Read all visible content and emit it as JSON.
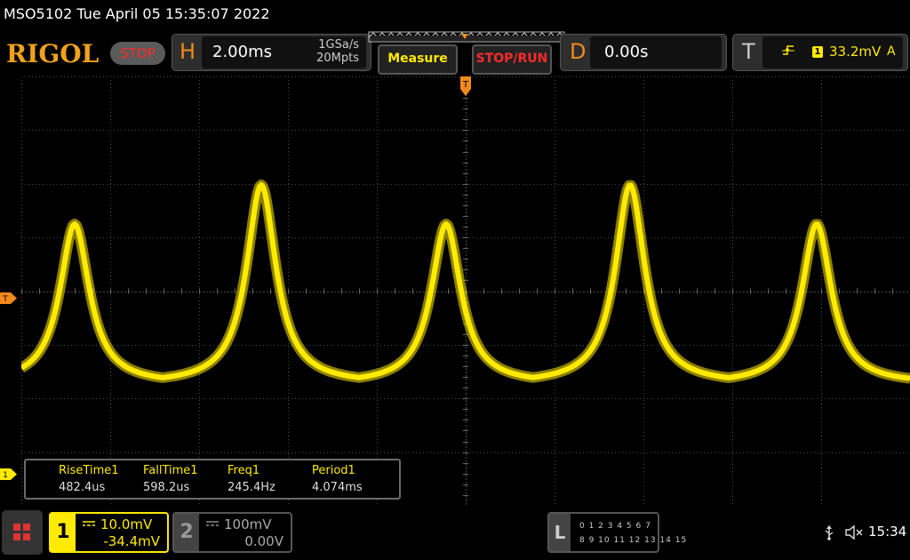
{
  "titlebar": {
    "text": "MSO5102  Tue April 05 15:35:07 2022"
  },
  "toolbar": {
    "logo": "RIGOL",
    "run_state": "STOP",
    "horizontal": {
      "letter": "H",
      "timebase": "2.00ms",
      "sample_rate": "1GSa/s",
      "memory_depth": "20Mpts"
    },
    "measure_label": "Measure",
    "stop_run_label": "STOP/RUN",
    "delay": {
      "letter": "D",
      "value": "0.00s"
    },
    "trigger": {
      "letter": "T",
      "source": "1",
      "level": "33.2mV",
      "mode": "A",
      "edge_icon": "rising-edge-icon"
    }
  },
  "markers": {
    "trigger_level": "T",
    "ch1_ground": "1"
  },
  "measurements": [
    {
      "label": "RiseTime1",
      "value": "482.4us"
    },
    {
      "label": "FallTime1",
      "value": "598.2us"
    },
    {
      "label": "Freq1",
      "value": "245.4Hz"
    },
    {
      "label": "Period1",
      "value": "4.074ms"
    }
  ],
  "channels": {
    "ch1": {
      "number": "1",
      "scale": "10.0mV",
      "offset": "-34.4mV",
      "color": "#ffea00"
    },
    "ch2": {
      "number": "2",
      "scale": "100mV",
      "offset": "0.00V",
      "color": "#888888"
    }
  },
  "logic": {
    "letter": "L",
    "row1": "0 1 2 3  4 5 6 7",
    "row2": "8 9 10 11 12 13 14 15"
  },
  "status": {
    "time": "15:34"
  },
  "colors": {
    "trace": "#ffea00",
    "accent": "#f28a1a",
    "stop": "#ff2a2a",
    "grid": "#4a4a4a"
  },
  "waveform": {
    "peaks": [
      {
        "x_div": 0.6,
        "height": "low"
      },
      {
        "x_div": 2.7,
        "height": "high"
      },
      {
        "x_div": 4.78,
        "height": "low"
      },
      {
        "x_div": 6.85,
        "height": "high"
      },
      {
        "x_div": 8.95,
        "height": "low"
      }
    ]
  }
}
